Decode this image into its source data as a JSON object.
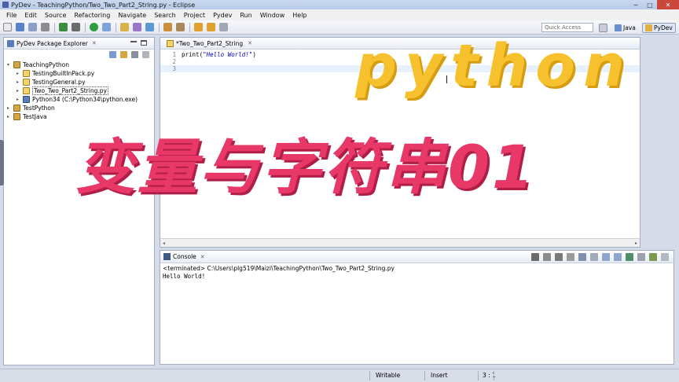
{
  "window": {
    "title": "PyDev - TeachingPython/Two_Two_Part2_String.py - Eclipse",
    "minimize": "─",
    "maximize": "□",
    "close": "✕"
  },
  "menu": [
    "File",
    "Edit",
    "Source",
    "Refactoring",
    "Navigate",
    "Search",
    "Project",
    "Pydev",
    "Run",
    "Window",
    "Help"
  ],
  "toolbar": {
    "quick_access_placeholder": "Quick Access",
    "perspectives": [
      "Java",
      "PyDev"
    ]
  },
  "explorer": {
    "tab_label": "PyDev Package Explorer",
    "tab_close": "✕",
    "tree": [
      {
        "label": "TeachingPython",
        "arrow": "▾",
        "type": "project"
      },
      {
        "label": "TestingBuiltInPack.py",
        "arrow": "▸",
        "type": "py"
      },
      {
        "label": "TestingGeneral.py",
        "arrow": "▸",
        "type": "py"
      },
      {
        "label": "Two_Two_Part2_String.py",
        "arrow": "▸",
        "type": "py"
      },
      {
        "label": "Python34  (C:\\Python34\\python.exe)",
        "arrow": "▸",
        "type": "interpreter"
      },
      {
        "label": "TestPython",
        "arrow": "▸",
        "type": "project"
      },
      {
        "label": "TestJava",
        "arrow": "▸",
        "type": "project"
      }
    ]
  },
  "editor": {
    "tab_label": "*Two_Two_Part2_String",
    "tab_close": "✕",
    "lines": [
      {
        "num": "1",
        "fn": "print(",
        "str": "\"Hello World!\"",
        "end": ")"
      },
      {
        "num": "2",
        "fn": "",
        "str": "",
        "end": ""
      },
      {
        "num": "3",
        "fn": "",
        "str": "",
        "end": ""
      }
    ],
    "scroll_left": "◂",
    "scroll_right": "▸"
  },
  "console": {
    "tab_label": "Console",
    "tab_close": "✕",
    "terminated_line": "<terminated> C:\\Users\\plg519\\Maizi\\TeachingPython\\Two_Two_Part2_String.py",
    "output": "Hello World!"
  },
  "status": {
    "writable": "Writable",
    "insert": "Insert",
    "position": "3 : 1"
  },
  "overlay": {
    "title_en": "python",
    "title_cn": "变量与字符串01"
  },
  "colors": {
    "overlay_yellow": "#f7c12e",
    "overlay_pink": "#e83868",
    "string_literal": "#0000c0",
    "current_line": "#e8f2fe"
  }
}
